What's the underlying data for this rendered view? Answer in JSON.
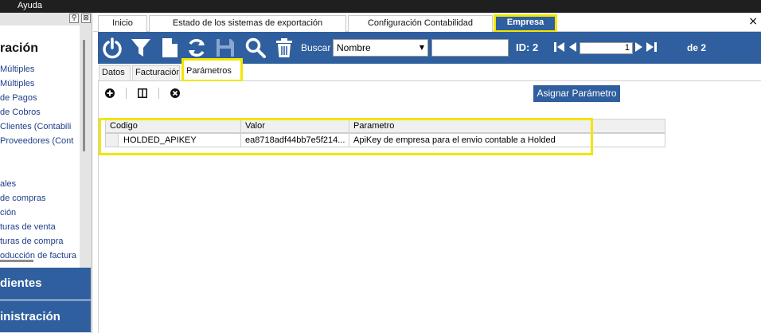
{
  "menubar": {
    "help_label": "Ayuda"
  },
  "sidebar": {
    "section_title": "ración",
    "items": [
      "Múltiples",
      "Múltiples",
      "de Pagos",
      "de Cobros",
      "Clientes (Contabili",
      "Proveedores (Cont",
      "",
      "",
      "ales",
      "de compras",
      "ción",
      "turas de venta",
      "turas de compra",
      "oducción de factura"
    ],
    "button_pending": "dientes",
    "button_admin": "inistración"
  },
  "tabs": {
    "inicio": "Inicio",
    "estado": "Estado de los sistemas de exportación",
    "configuracion": "Configuración Contabilidad",
    "empresa": "Empresa",
    "close": "×"
  },
  "toolbar": {
    "search_label": "Buscar",
    "search_field_selected": "Nombre",
    "search_value": "",
    "id_label": "ID: 2",
    "page_value": "1",
    "page_total": "de 2"
  },
  "subtabs": {
    "datos": "Datos",
    "facturacion": "Facturación",
    "parametros": "Parámetros"
  },
  "subpanel": {
    "assign_button": "Asignar Parámetro"
  },
  "grid": {
    "columns": [
      "Codigo",
      "Valor",
      "Parametro"
    ],
    "rows": [
      [
        "HOLDED_APIKEY",
        "ea8718adf44bb7e5f214...",
        "ApiKey de empresa para el envio contable a Holded"
      ]
    ]
  },
  "colors": {
    "brand_blue": "#2f5f9e",
    "highlight_yellow": "#f2e600"
  },
  "icons": [
    "power-icon",
    "filter-icon",
    "new-document-icon",
    "refresh-icon",
    "save-icon",
    "search-icon",
    "delete-icon",
    "first-page-icon",
    "previous-page-icon",
    "next-page-icon",
    "last-page-icon",
    "add-icon",
    "columns-icon",
    "remove-icon"
  ]
}
